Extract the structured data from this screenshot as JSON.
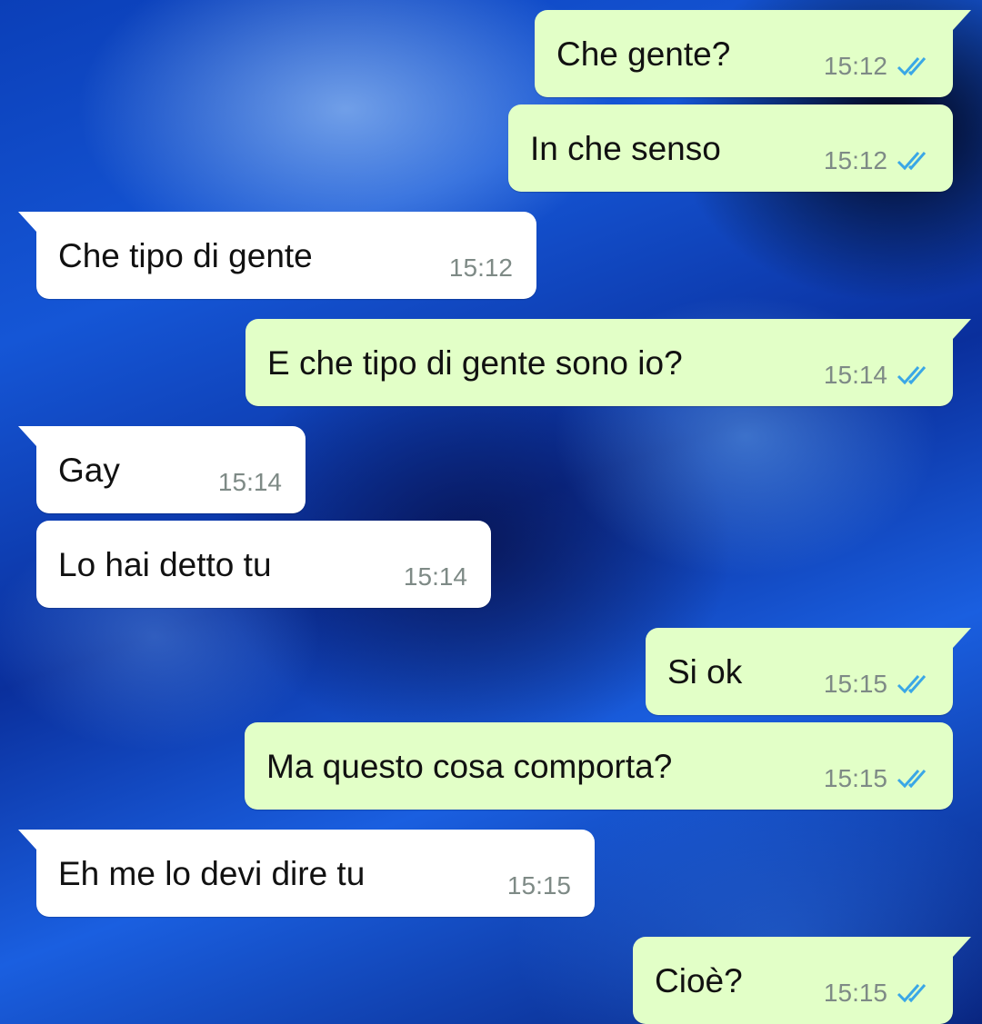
{
  "messages": [
    {
      "direction": "out",
      "text": "Che gente?",
      "time": "15:12",
      "status_icon": "double-check-read-icon"
    },
    {
      "direction": "out",
      "text": "In che senso",
      "time": "15:12",
      "status_icon": "double-check-read-icon"
    },
    {
      "direction": "in",
      "text": "Che tipo di gente",
      "time": "15:12"
    },
    {
      "direction": "out",
      "text": "E che tipo di gente sono io?",
      "time": "15:14",
      "status_icon": "double-check-read-icon"
    },
    {
      "direction": "in",
      "text": "Gay",
      "time": "15:14"
    },
    {
      "direction": "in",
      "text": "Lo hai detto tu",
      "time": "15:14"
    },
    {
      "direction": "out",
      "text": "Si ok",
      "time": "15:15",
      "status_icon": "double-check-read-icon"
    },
    {
      "direction": "out",
      "text": "Ma questo cosa comporta?",
      "time": "15:15",
      "status_icon": "double-check-read-icon"
    },
    {
      "direction": "in",
      "text": "Eh me lo devi dire tu",
      "time": "15:15"
    },
    {
      "direction": "out",
      "text": "Cioè?",
      "time": "15:15",
      "status_icon": "double-check-read-icon"
    }
  ],
  "colors": {
    "outgoing_bubble": "#e2ffc7",
    "incoming_bubble": "#ffffff",
    "read_tick": "#3aa7e6",
    "timestamp": "#7e8a86"
  }
}
